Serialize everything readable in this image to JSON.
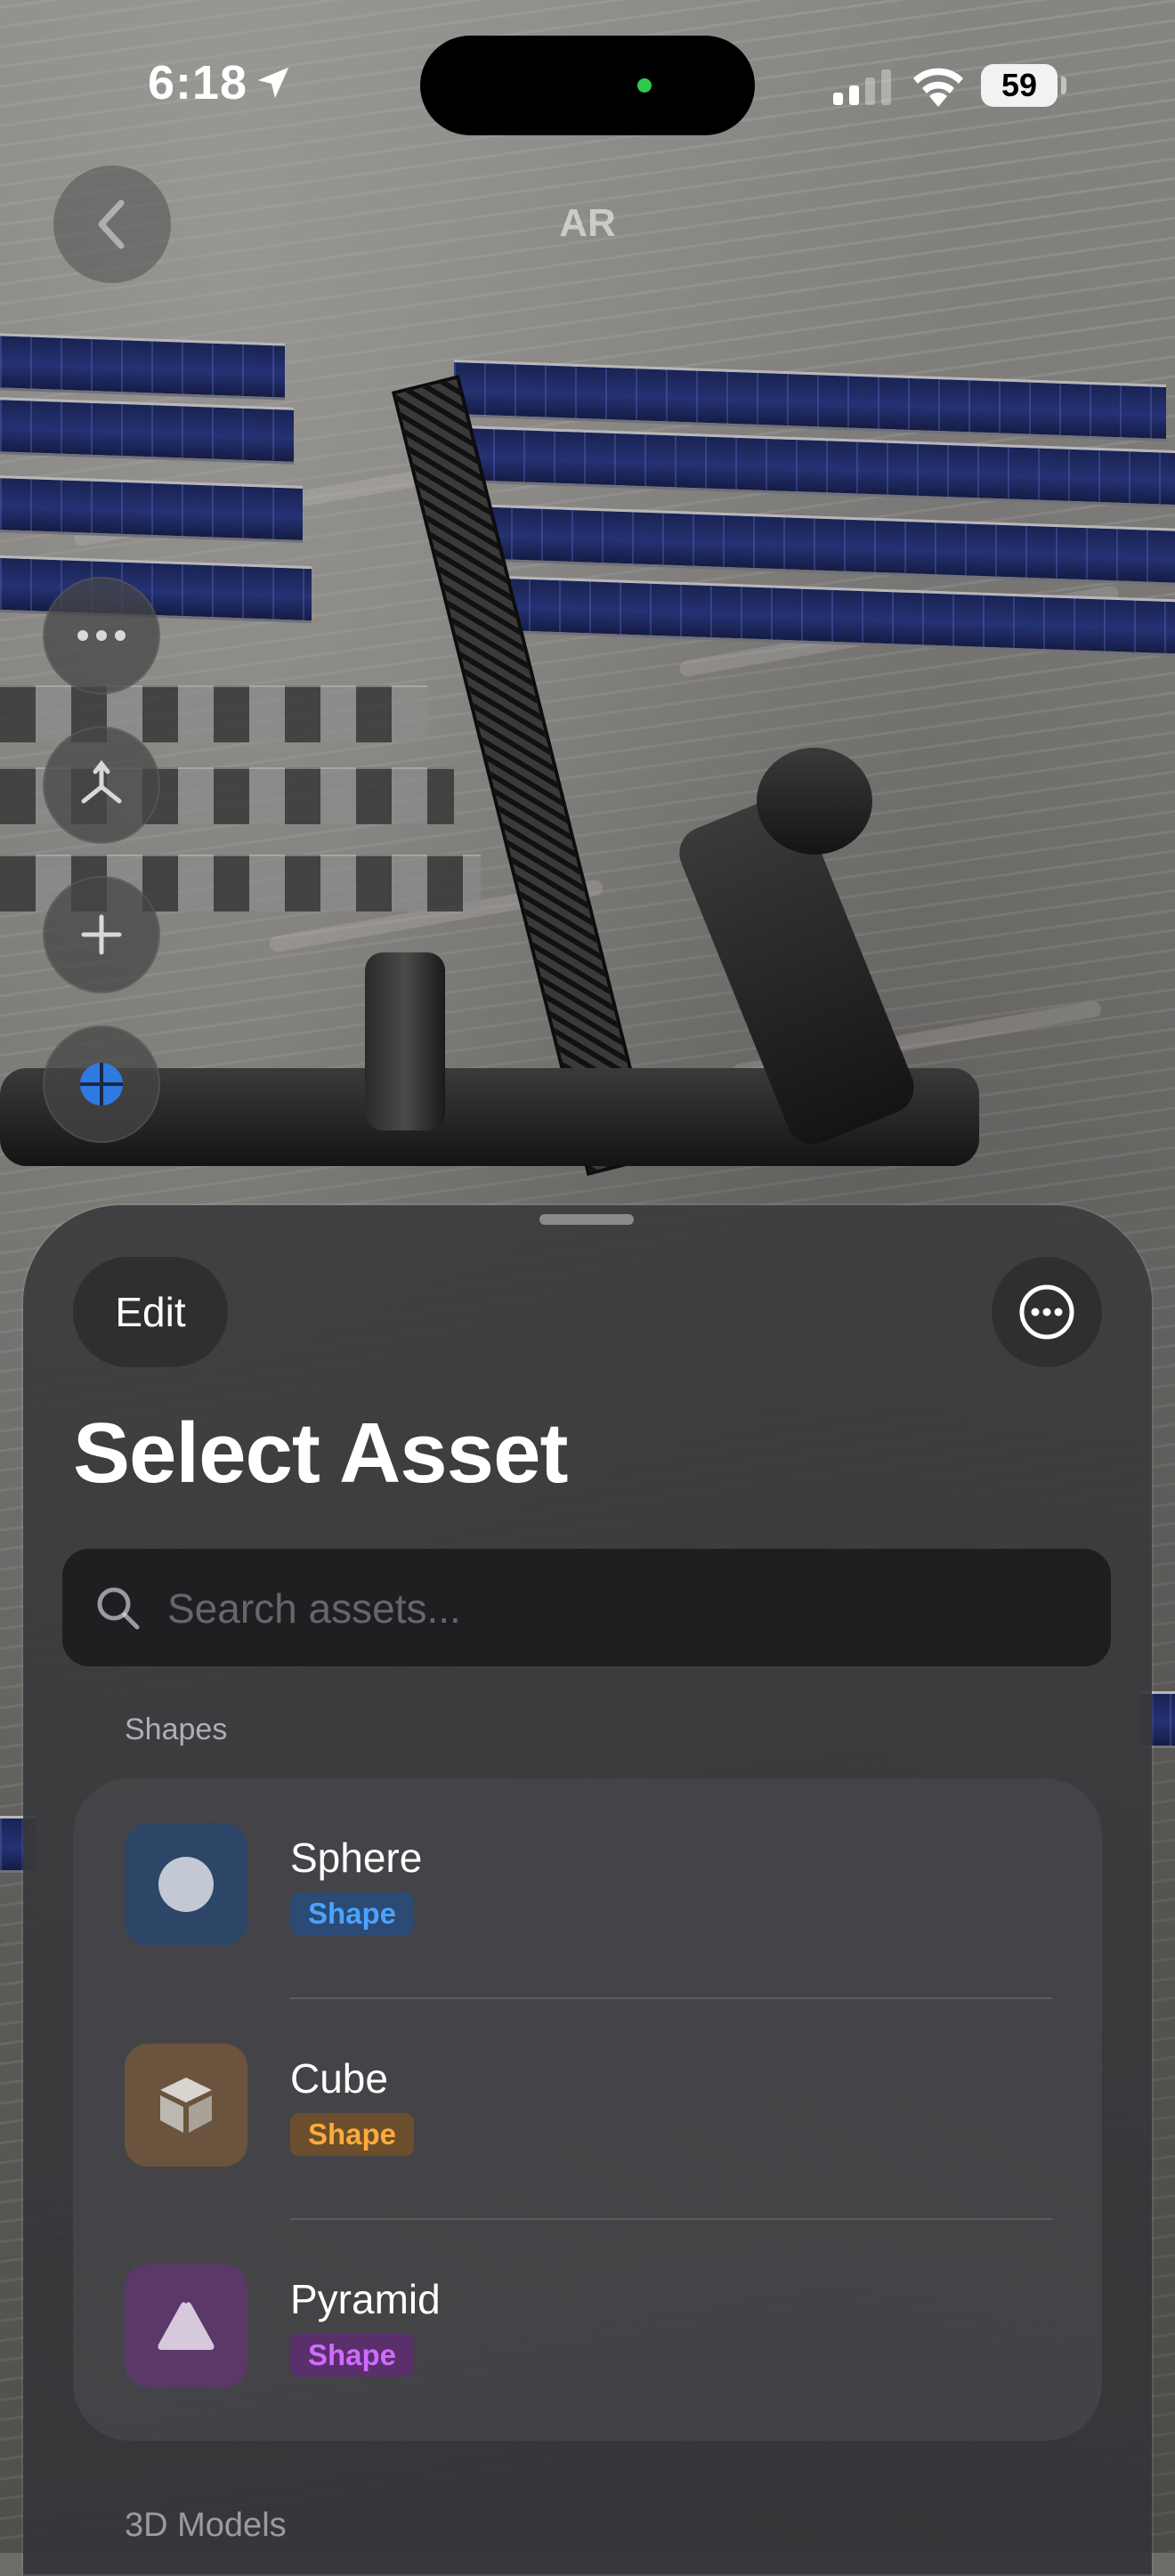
{
  "status_bar": {
    "time": "6:18",
    "battery": "59"
  },
  "nav": {
    "title": "AR"
  },
  "sheet": {
    "edit_label": "Edit",
    "title": "Select Asset",
    "search_placeholder": "Search assets...",
    "section_shapes": "Shapes",
    "items": [
      {
        "name": "Sphere",
        "badge": "Shape",
        "icon": "circle-icon",
        "tile_color": "#2d4566",
        "badge_bg": "#2b4a74",
        "badge_color": "#4aa3ff"
      },
      {
        "name": "Cube",
        "badge": "Shape",
        "icon": "cube-icon",
        "tile_color": "#6a543d",
        "badge_bg": "#6b4e2c",
        "badge_color": "#ffaa3a"
      },
      {
        "name": "Pyramid",
        "badge": "Shape",
        "icon": "triangle-icon",
        "tile_color": "#5a3868",
        "badge_bg": "#5a2f6c",
        "badge_color": "#d06bff"
      }
    ],
    "section_next": "3D Models"
  }
}
